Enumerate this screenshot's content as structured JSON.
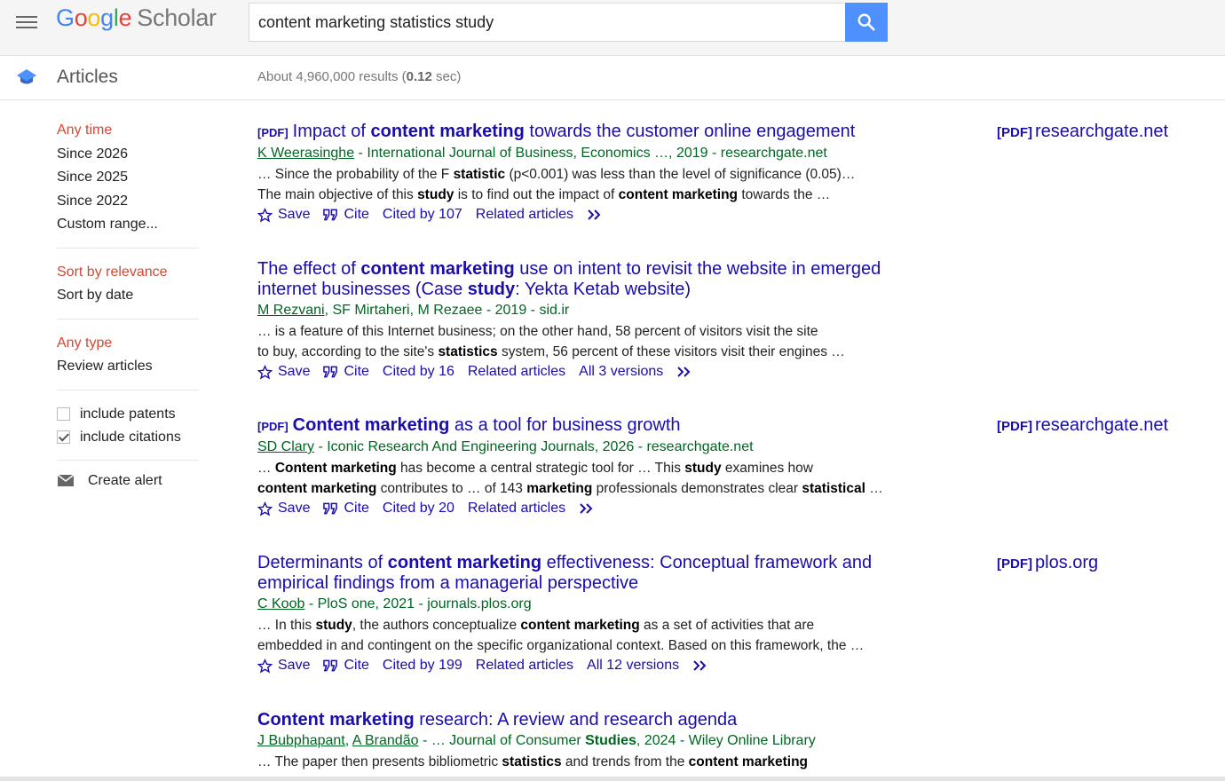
{
  "header": {
    "logo_letters": [
      "G",
      "o",
      "o",
      "g",
      "l",
      "e"
    ],
    "logo_scholar": "Scholar",
    "search_value": "content marketing statistics study"
  },
  "subbar": {
    "section": "Articles",
    "stats_prefix": "About 4,960,000 results (",
    "stats_time": "0.12",
    "stats_suffix": " sec)"
  },
  "sidebar": {
    "time_filters": [
      "Any time",
      "Since 2026",
      "Since 2025",
      "Since 2022",
      "Custom range..."
    ],
    "sort_filters": [
      "Sort by relevance",
      "Sort by date"
    ],
    "type_filters": [
      "Any type",
      "Review articles"
    ],
    "include_patents": "include patents",
    "include_citations": "include citations",
    "create_alert": "Create alert"
  },
  "pdf_tag": "[PDF]",
  "actions": {
    "save": "Save",
    "cite": "Cite",
    "related": "Related articles"
  },
  "results": [
    {
      "pdf_prefix": true,
      "title": [
        [
          "Impact of ",
          false
        ],
        [
          "content marketing",
          true
        ],
        [
          " towards the customer online engagement",
          false
        ]
      ],
      "authors": [
        [
          "K Weerasinghe",
          true
        ],
        [
          " - International Journal of Business, Economics …, 2019 - researchgate.net",
          false
        ]
      ],
      "snippet": [
        [
          "… Since the probability of the F ",
          false
        ],
        [
          "statistic",
          true
        ],
        [
          " (p<0.001) was less than the level of significance (0.05)…",
          false
        ],
        [
          "\n",
          false
        ],
        [
          "The main objective of this ",
          false
        ],
        [
          "study",
          true
        ],
        [
          " is to find out the impact of ",
          false
        ],
        [
          "content marketing",
          true
        ],
        [
          " towards the …",
          false
        ]
      ],
      "cited_by": "Cited by 107",
      "versions": "",
      "side_source": "researchgate.net"
    },
    {
      "pdf_prefix": false,
      "title": [
        [
          "The effect of ",
          false
        ],
        [
          "content marketing",
          true
        ],
        [
          " use on intent to revisit the website in emerged internet businesses (Case ",
          false
        ],
        [
          "study",
          true
        ],
        [
          ": Yekta Ketab website)",
          false
        ]
      ],
      "authors": [
        [
          "M Rezvani",
          true
        ],
        [
          ", SF Mirtaheri, M Rezaee - 2019 - sid.ir",
          false
        ]
      ],
      "snippet": [
        [
          "… is a feature of this Internet business; on the other hand, 58 percent of visitors visit the site",
          false
        ],
        [
          "\n",
          false
        ],
        [
          "to buy, according to the site's ",
          false
        ],
        [
          "statistics",
          true
        ],
        [
          " system, 56 percent of these visitors visit their engines …",
          false
        ]
      ],
      "cited_by": "Cited by 16",
      "versions": "All 3 versions",
      "side_source": ""
    },
    {
      "pdf_prefix": true,
      "title": [
        [
          "Content marketing",
          true
        ],
        [
          " as a tool for business growth",
          false
        ]
      ],
      "authors": [
        [
          "SD Clary",
          true
        ],
        [
          " - Iconic Research And Engineering Journals, 2026 - researchgate.net",
          false
        ]
      ],
      "snippet": [
        [
          "… ",
          false
        ],
        [
          "Content marketing",
          true
        ],
        [
          " has become a central strategic tool for … This ",
          false
        ],
        [
          "study",
          true
        ],
        [
          " examines how",
          false
        ],
        [
          "\n",
          false
        ],
        [
          "content marketing",
          true
        ],
        [
          " contributes to … of 143 ",
          false
        ],
        [
          "marketing",
          true
        ],
        [
          " professionals demonstrates clear ",
          false
        ],
        [
          "statistical",
          true
        ],
        [
          " …",
          false
        ]
      ],
      "cited_by": "Cited by 20",
      "versions": "",
      "side_source": "researchgate.net"
    },
    {
      "pdf_prefix": false,
      "title": [
        [
          "Determinants of ",
          false
        ],
        [
          "content marketing",
          true
        ],
        [
          " effectiveness: Conceptual framework and empirical findings from a managerial perspective",
          false
        ]
      ],
      "authors": [
        [
          "C Koob",
          true
        ],
        [
          " - PloS one, 2021 - journals.plos.org",
          false
        ]
      ],
      "snippet": [
        [
          "… In this ",
          false
        ],
        [
          "study",
          true
        ],
        [
          ", the authors conceptualize ",
          false
        ],
        [
          "content marketing",
          true
        ],
        [
          " as a set of activities that are",
          false
        ],
        [
          "\n",
          false
        ],
        [
          "embedded in and contingent on the specific organizational context. Based on this framework, the …",
          false
        ]
      ],
      "cited_by": "Cited by 199",
      "versions": "All 12 versions",
      "side_source": "plos.org"
    },
    {
      "pdf_prefix": false,
      "title": [
        [
          "Content marketing",
          true
        ],
        [
          " research: A review and research agenda",
          false
        ]
      ],
      "authors": [
        [
          "J Bubphapant",
          true
        ],
        [
          ", ",
          false
        ],
        [
          "A Brandão",
          true
        ],
        [
          " - … Journal of Consumer ",
          false
        ],
        [
          "Studies",
          "bold"
        ],
        [
          ", 2024 - Wiley Online Library",
          false
        ]
      ],
      "snippet": [
        [
          "… The paper then presents bibliometric ",
          false
        ],
        [
          "statistics",
          true
        ],
        [
          " and trends from the ",
          false
        ],
        [
          "content marketing",
          true
        ]
      ],
      "cited_by": "",
      "versions": "",
      "side_source": ""
    }
  ]
}
